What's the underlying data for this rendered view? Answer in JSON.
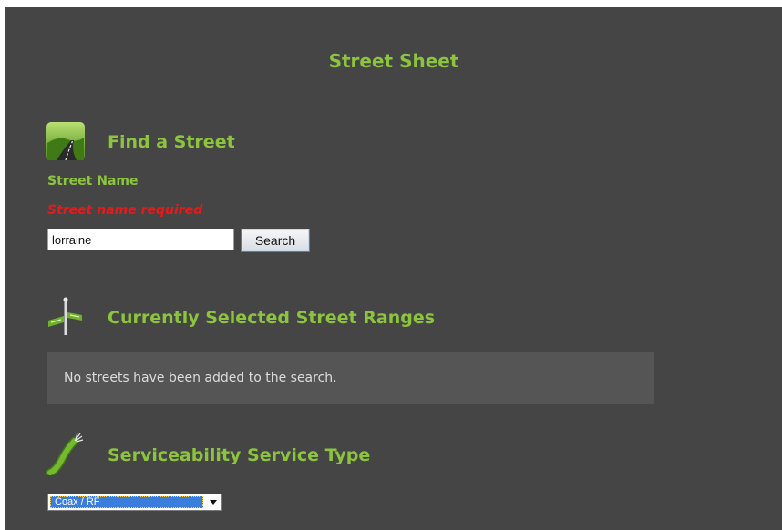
{
  "page_title": "Street Sheet",
  "find_street": {
    "title": "Find a Street",
    "icon": "road-icon",
    "field_label": "Street Name",
    "error": "Street name required",
    "input_value": "lorraine",
    "search_label": "Search"
  },
  "selected_ranges": {
    "title": "Currently Selected Street Ranges",
    "icon": "street-sign-icon",
    "empty_message": "No streets have been added to the search."
  },
  "service_type": {
    "title": "Serviceability Service Type",
    "icon": "cable-icon",
    "selected": "Coax / RF"
  },
  "colors": {
    "panel_bg": "#454545",
    "accent_green": "#8cc43d",
    "error_red": "#e51a1a",
    "empty_box_bg": "#555555"
  }
}
